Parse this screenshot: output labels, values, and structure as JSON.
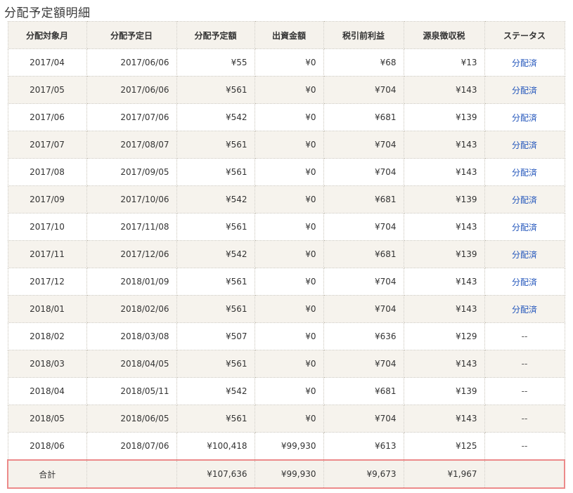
{
  "title": "分配予定額明細",
  "headers": [
    "分配対象月",
    "分配予定日",
    "分配予定額",
    "出資金額",
    "税引前利益",
    "源泉徴収税",
    "ステータス"
  ],
  "rows": [
    {
      "month": "2017/04",
      "date": "2017/06/06",
      "amount": "¥55",
      "investment": "¥0",
      "pretax": "¥68",
      "tax": "¥13",
      "status": "分配済",
      "paid": true
    },
    {
      "month": "2017/05",
      "date": "2017/06/06",
      "amount": "¥561",
      "investment": "¥0",
      "pretax": "¥704",
      "tax": "¥143",
      "status": "分配済",
      "paid": true
    },
    {
      "month": "2017/06",
      "date": "2017/07/06",
      "amount": "¥542",
      "investment": "¥0",
      "pretax": "¥681",
      "tax": "¥139",
      "status": "分配済",
      "paid": true
    },
    {
      "month": "2017/07",
      "date": "2017/08/07",
      "amount": "¥561",
      "investment": "¥0",
      "pretax": "¥704",
      "tax": "¥143",
      "status": "分配済",
      "paid": true
    },
    {
      "month": "2017/08",
      "date": "2017/09/05",
      "amount": "¥561",
      "investment": "¥0",
      "pretax": "¥704",
      "tax": "¥143",
      "status": "分配済",
      "paid": true
    },
    {
      "month": "2017/09",
      "date": "2017/10/06",
      "amount": "¥542",
      "investment": "¥0",
      "pretax": "¥681",
      "tax": "¥139",
      "status": "分配済",
      "paid": true
    },
    {
      "month": "2017/10",
      "date": "2017/11/08",
      "amount": "¥561",
      "investment": "¥0",
      "pretax": "¥704",
      "tax": "¥143",
      "status": "分配済",
      "paid": true
    },
    {
      "month": "2017/11",
      "date": "2017/12/06",
      "amount": "¥542",
      "investment": "¥0",
      "pretax": "¥681",
      "tax": "¥139",
      "status": "分配済",
      "paid": true
    },
    {
      "month": "2017/12",
      "date": "2018/01/09",
      "amount": "¥561",
      "investment": "¥0",
      "pretax": "¥704",
      "tax": "¥143",
      "status": "分配済",
      "paid": true
    },
    {
      "month": "2018/01",
      "date": "2018/02/06",
      "amount": "¥561",
      "investment": "¥0",
      "pretax": "¥704",
      "tax": "¥143",
      "status": "分配済",
      "paid": true
    },
    {
      "month": "2018/02",
      "date": "2018/03/08",
      "amount": "¥507",
      "investment": "¥0",
      "pretax": "¥636",
      "tax": "¥129",
      "status": "--",
      "paid": false
    },
    {
      "month": "2018/03",
      "date": "2018/04/05",
      "amount": "¥561",
      "investment": "¥0",
      "pretax": "¥704",
      "tax": "¥143",
      "status": "--",
      "paid": false
    },
    {
      "month": "2018/04",
      "date": "2018/05/11",
      "amount": "¥542",
      "investment": "¥0",
      "pretax": "¥681",
      "tax": "¥139",
      "status": "--",
      "paid": false
    },
    {
      "month": "2018/05",
      "date": "2018/06/05",
      "amount": "¥561",
      "investment": "¥0",
      "pretax": "¥704",
      "tax": "¥143",
      "status": "--",
      "paid": false
    },
    {
      "month": "2018/06",
      "date": "2018/07/06",
      "amount": "¥100,418",
      "investment": "¥99,930",
      "pretax": "¥613",
      "tax": "¥125",
      "status": "--",
      "paid": false
    }
  ],
  "total": {
    "label": "合計",
    "amount": "¥107,636",
    "investment": "¥99,930",
    "pretax": "¥9,673",
    "tax": "¥1,967"
  },
  "colors": {
    "link": "#2255bb",
    "row_alt": "#f6f3ed",
    "total_border": "#ec8a8a"
  }
}
